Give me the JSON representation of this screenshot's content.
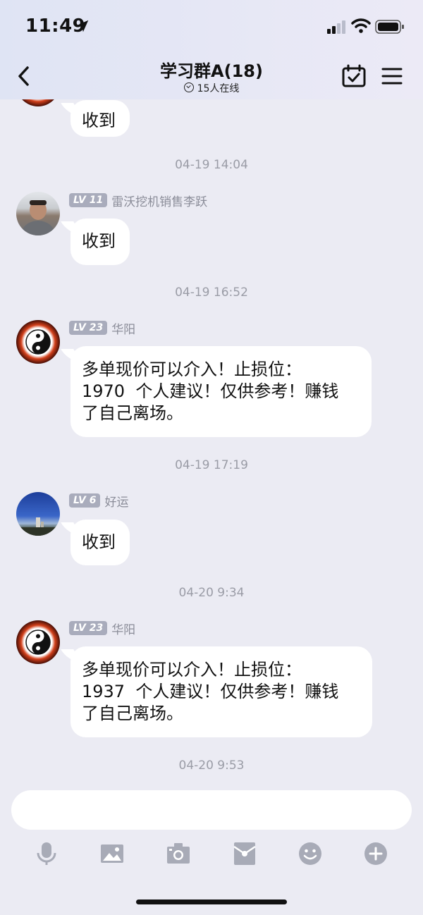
{
  "status_bar": {
    "time": "11:49"
  },
  "header": {
    "title": "学习群A(18)",
    "online": "15人在线"
  },
  "messages": [
    {
      "type": "message",
      "avatar": "taiji",
      "text": "收到"
    },
    {
      "type": "time",
      "text": "04-19 14:04"
    },
    {
      "type": "message",
      "avatar": "person",
      "level": "LV 11",
      "name": "雷沃挖机销售李跃",
      "text": "收到"
    },
    {
      "type": "time",
      "text": "04-19 16:52"
    },
    {
      "type": "message",
      "avatar": "taiji",
      "level": "LV 23",
      "name": "华阳",
      "lines": [
        "多单现价可以介入！止损位：",
        "1970  个人建议！仅供参考！赚钱",
        "了自己离场。"
      ]
    },
    {
      "type": "time",
      "text": "04-19 17:19"
    },
    {
      "type": "message",
      "avatar": "sky",
      "level": "LV 6",
      "name": "好运",
      "text": "收到"
    },
    {
      "type": "time",
      "text": "04-20 9:34"
    },
    {
      "type": "message",
      "avatar": "taiji",
      "level": "LV 23",
      "name": "华阳",
      "lines": [
        "多单现价可以介入！止损位：",
        "1937  个人建议！仅供参考！赚钱",
        "了自己离场。"
      ]
    },
    {
      "type": "time",
      "text": "04-20 9:53"
    }
  ],
  "composer": {
    "placeholder": "",
    "tools": [
      "microphone-icon",
      "image-icon",
      "camera-icon",
      "red-packet-icon",
      "emoji-icon",
      "plus-icon"
    ]
  },
  "colors": {
    "background": "#ebebf3",
    "bubble": "#ffffff",
    "level_badge": "#a9acbc",
    "timestamp": "#9a9ca6"
  }
}
